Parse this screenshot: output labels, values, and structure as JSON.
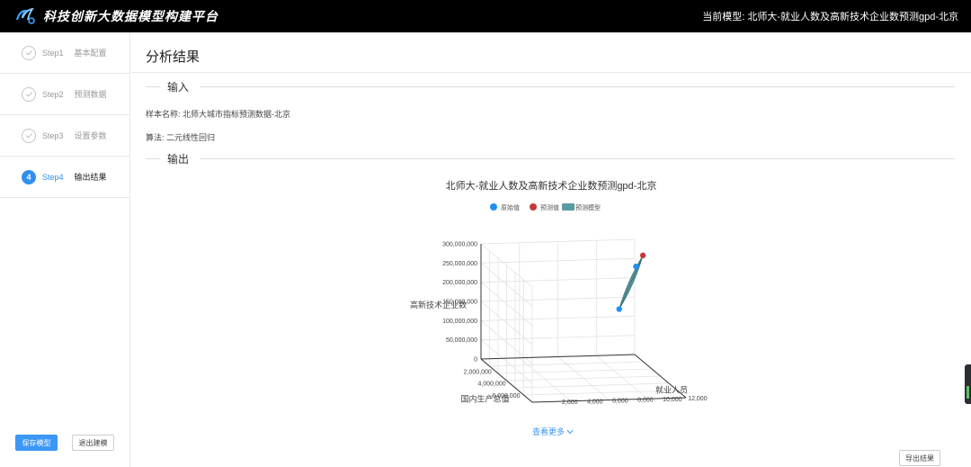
{
  "header": {
    "brand_title": "科技创新大数据模型构建平台",
    "current_model": "当前模型: 北师大-就业人数及高新技术企业数预测gpd-北京"
  },
  "sidebar": {
    "steps": [
      {
        "no": "Step1",
        "label": "基本配置",
        "state": "done"
      },
      {
        "no": "Step2",
        "label": "预测数据",
        "state": "done"
      },
      {
        "no": "Step3",
        "label": "设置参数",
        "state": "done"
      },
      {
        "no": "Step4",
        "label": "输出结果",
        "state": "active",
        "badge": "4"
      }
    ],
    "save_label": "保存模型",
    "exit_label": "退出建模"
  },
  "main": {
    "title": "分析结果",
    "input_section": "输入",
    "sample_label": "样本名称: ",
    "sample_value": "北师大城市指标预测数据-北京",
    "algo_label": "算法: ",
    "algo_value": "二元线性回归",
    "output_section": "输出",
    "more_label": "查看更多",
    "export_label": "导出结果"
  },
  "colors": {
    "accent": "#3c97f5",
    "original": "#1e8ff5",
    "predicted": "#c6383a",
    "model": "#5a9aa0"
  },
  "chart_data": {
    "type": "scatter",
    "title": "北师大-就业人数及高新技术企业数预测gpd-北京",
    "legend": [
      "原始值",
      "预测值",
      "预测模型"
    ],
    "legend_position": "top-center",
    "zlabel": "高新技术企业数",
    "xlabel": "国内生产总值",
    "ylabel": "就业人员",
    "z_ticks": [
      "0",
      "50,000,000",
      "100,000,000",
      "150,000,000",
      "200,000,000",
      "250,000,000",
      "300,000,000"
    ],
    "x_ticks": [
      "2,000,000",
      "4,000,000",
      "6,000,000"
    ],
    "y_ticks": [
      "2,000",
      "4,000",
      "6,000",
      "8,000",
      "10,000",
      "12,000"
    ],
    "series": [
      {
        "name": "原始值",
        "points": [
          {
            "x": 1200000,
            "y": 10500,
            "z": 140000000
          },
          {
            "x": 1800000,
            "y": 11500,
            "z": 260000000
          }
        ]
      },
      {
        "name": "预测值",
        "points": [
          {
            "x": 1900000,
            "y": 12000,
            "z": 290000000
          }
        ]
      },
      {
        "name": "预测模型",
        "points": [
          {
            "x": 1200000,
            "y": 10500,
            "z": 140000000
          },
          {
            "x": 1900000,
            "y": 12000,
            "z": 290000000
          }
        ]
      }
    ]
  }
}
